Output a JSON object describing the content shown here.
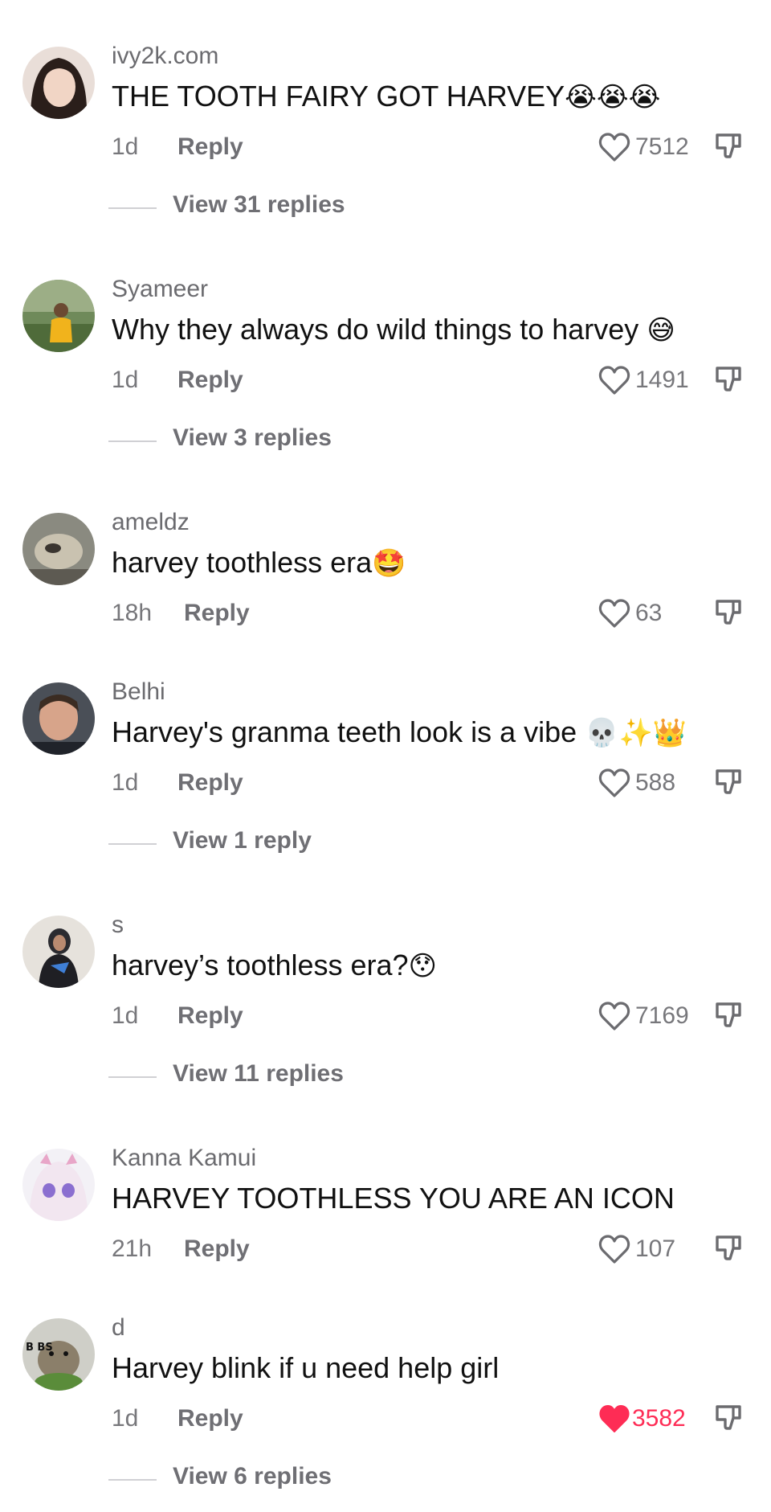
{
  "comments": [
    {
      "username": "ivy2k.com",
      "text": "THE TOOTH FAIRY GOT HARVEY",
      "emoji": "😭😭😭",
      "time": "1d",
      "reply": "Reply",
      "likes": "7512",
      "liked": false,
      "view_replies": "View 31 replies"
    },
    {
      "username": "Syameer",
      "text": "Why they always do wild things to harvey ",
      "emoji": "😅",
      "time": "1d",
      "reply": "Reply",
      "likes": "1491",
      "liked": false,
      "view_replies": "View 3 replies"
    },
    {
      "username": "ameldz",
      "text": "harvey toothless era",
      "emoji": "🤩",
      "time": "18h",
      "reply": "Reply",
      "likes": "63",
      "liked": false,
      "view_replies": ""
    },
    {
      "username": "Belhi",
      "text": "Harvey's granma teeth look is a vibe ",
      "emoji": "💀✨👑",
      "time": "1d",
      "reply": "Reply",
      "likes": "588",
      "liked": false,
      "view_replies": "View 1 reply"
    },
    {
      "username": "s",
      "text": "harvey’s toothless era?",
      "emoji": "😯",
      "time": "1d",
      "reply": "Reply",
      "likes": "7169",
      "liked": false,
      "view_replies": "View 11 replies"
    },
    {
      "username": "Kanna Kamui",
      "text": "HARVEY TOOTHLESS YOU ARE AN ICON",
      "emoji": "",
      "time": "21h",
      "reply": "Reply",
      "likes": "107",
      "liked": false,
      "view_replies": ""
    },
    {
      "username": "d",
      "text": "Harvey blink if u need help girl",
      "emoji": "",
      "time": "1d",
      "reply": "Reply",
      "likes": "3582",
      "liked": true,
      "view_replies": "View 6 replies"
    }
  ],
  "avatars": [
    {
      "name": "ivy2k-avatar",
      "text": ""
    },
    {
      "name": "syameer-avatar",
      "text": ""
    },
    {
      "name": "ameldz-avatar",
      "text": ""
    },
    {
      "name": "belhi-avatar",
      "text": ""
    },
    {
      "name": "s-avatar",
      "text": ""
    },
    {
      "name": "kanna-avatar",
      "text": ""
    },
    {
      "name": "d-avatar",
      "text": "B   BS"
    }
  ],
  "colors": {
    "like_active": "#fe2c55",
    "muted": "#77777b",
    "text": "#111111"
  },
  "icons": {
    "like": "heart-outline-icon",
    "liked": "heart-filled-icon",
    "dislike": "thumbs-down-icon"
  }
}
